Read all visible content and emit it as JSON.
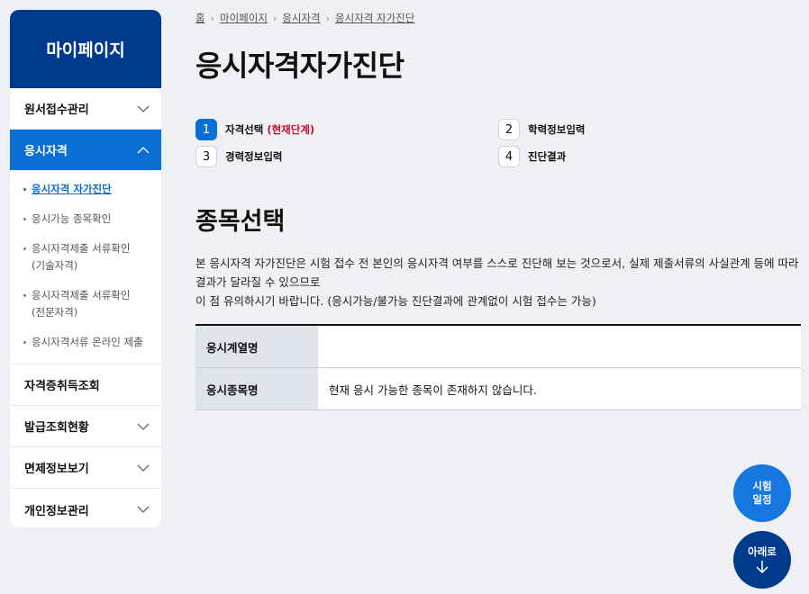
{
  "sidebar": {
    "title": "마이페이지",
    "items": [
      {
        "label": "원서접수관리"
      },
      {
        "label": "응시자격"
      },
      {
        "label": "자격증취득조회"
      },
      {
        "label": "발급조회현황"
      },
      {
        "label": "면제정보보기"
      },
      {
        "label": "개인정보관리"
      }
    ],
    "sub_items": [
      {
        "label": "응시자격 자가진단"
      },
      {
        "label": "응시가능 종목확인"
      },
      {
        "label": "응시자격제출 서류확인\n(기술자격)"
      },
      {
        "label": "응시자격제출 서류확인\n(전문자격)"
      },
      {
        "label": "응시자격서류 온라인 제출"
      }
    ]
  },
  "breadcrumb": {
    "home": "홈",
    "level1": "마이페이지",
    "level2": "응시자격",
    "level3": "응시자격 자가진단"
  },
  "page": {
    "title": "응시자격자가진단",
    "section_title": "종목선택",
    "description_line1": "본 응시자격 자가진단은 시험 접수 전 본인의 응시자격 여부를 스스로 진단해 보는 것으로서, 실제 제출서류의 사실관계 등에 따라 결과가 달라질 수 있으므로",
    "description_line2": "이 점 유의하시기 바랍니다. (응시가능/불가능 진단결과에 관계없이 시험 접수는 가능)"
  },
  "steps": [
    {
      "num": "1",
      "label": "자격선택",
      "current": "(현재단계)"
    },
    {
      "num": "2",
      "label": "학력정보입력"
    },
    {
      "num": "3",
      "label": "경력정보입력"
    },
    {
      "num": "4",
      "label": "진단결과"
    }
  ],
  "table": {
    "row1_header": "응시계열명",
    "row1_value": "",
    "row2_header": "응시종목명",
    "row2_value": "현재 응시 가능한 종목이 존재하지 않습니다."
  },
  "fab": {
    "schedule_line1": "시험",
    "schedule_line2": "일정",
    "down_label": "아래로"
  },
  "colors": {
    "brand_dark": "#003a8c",
    "brand_blue": "#0a6fd4",
    "current_step_red": "#c8102e"
  }
}
